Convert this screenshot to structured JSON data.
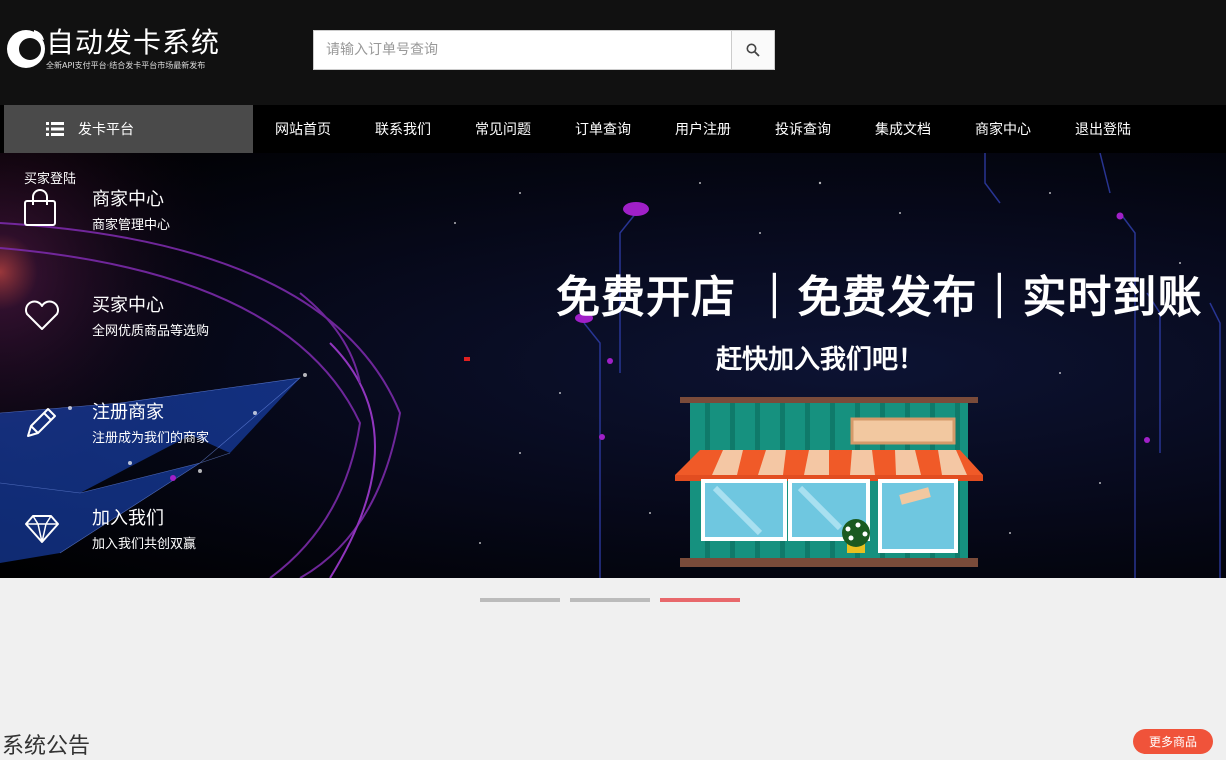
{
  "header": {
    "logo_title": "自动发卡系统",
    "logo_subtitle": "全新API支付平台·结合发卡平台市场最新发布",
    "search_placeholder": "请输入订单号查询"
  },
  "nav": {
    "category_label": "发卡平台",
    "links": [
      "网站首页",
      "联系我们",
      "常见问题",
      "订单查询",
      "用户注册",
      "投诉查询",
      "集成文档",
      "商家中心",
      "退出登陆"
    ]
  },
  "banner": {
    "buyer_login": "买家登陆",
    "side_items": [
      {
        "title": "商家中心",
        "subtitle": "商家管理中心",
        "icon": "shopping-bag-icon"
      },
      {
        "title": "买家中心",
        "subtitle": "全网优质商品等选购",
        "icon": "heart-icon"
      },
      {
        "title": "注册商家",
        "subtitle": "注册成为我们的商家",
        "icon": "pencil-icon"
      },
      {
        "title": "加入我们",
        "subtitle": "加入我们共创双赢",
        "icon": "diamond-icon"
      }
    ],
    "headline": "免费开店 ｜免费发布｜实时到账",
    "subline": "赶快加入我们吧！",
    "slide_count": 3,
    "active_slide": 3
  },
  "notice": {
    "title": "系统公告"
  },
  "more_button": "更多商品",
  "colors": {
    "accent": "#e8686b",
    "more_button": "#f0533a",
    "nav_bg": "#000000",
    "header_bg": "#111111"
  }
}
